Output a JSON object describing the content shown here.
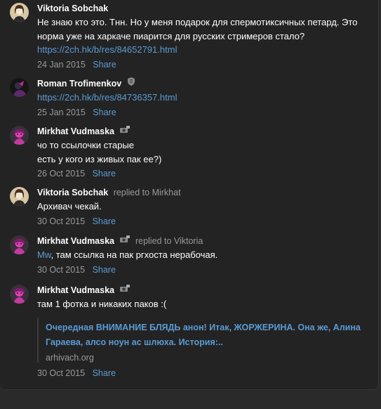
{
  "comments": [
    {
      "author": "Viktoria Sobchak",
      "line1": "Не знаю кто это. Тнн. Но у меня подарок для спермотиксичных петард. Это",
      "line2": "норма уже на харкаче пиарится для русских стримеров стало?",
      "link": "https://2ch.hk/b/res/84652791.html",
      "date": "24 Jan 2015",
      "share": "Share",
      "avatar_icon": "woman-portrait-avatar"
    },
    {
      "author": "Roman Trofimenkov",
      "badge_icon": "shield-icon",
      "link": "https://2ch.hk/b/res/84736357.html",
      "date": "25 Jan 2015",
      "share": "Share",
      "avatar_icon": "dark-figure-avatar"
    },
    {
      "author": "Mirkhat Vudmaska",
      "badge_icon": "camera-icon",
      "line1": "чо то ссылочки старые",
      "line2": "есть у кого из живых пак ее?)",
      "date": "26 Oct 2015",
      "share": "Share",
      "avatar_icon": "pink-character-avatar"
    },
    {
      "author": "Viktoria Sobchak",
      "replied": "replied to Mirkhat",
      "text": "Архивач чекай.",
      "date": "30 Oct 2015",
      "share": "Share",
      "avatar_icon": "woman-portrait-avatar"
    },
    {
      "author": "Mirkhat Vudmaska",
      "badge_icon": "camera-icon",
      "replied": "replied to Viktoria",
      "mention": "Mw",
      "text": ", там ссылка на пак ргхоста нерабочая.",
      "date": "30 Oct 2015",
      "share": "Share",
      "avatar_icon": "pink-character-avatar"
    },
    {
      "author": "Mirkhat Vudmaska",
      "badge_icon": "camera-icon",
      "text": "там 1 фотка и никаких паков :(",
      "quote_line1": "Очередная ВНИМАНИЕ БЛЯДЬ анон! Итак, ЖОРЖЕРИНА. Она же, Алина",
      "quote_line2": "Гараева, алсо ноун ас шлюха. История:..",
      "quote_domain": "arhivach.org",
      "date": "30 Oct 2015",
      "share": "Share",
      "avatar_icon": "pink-character-avatar"
    }
  ],
  "colors": {
    "background": "#2a2a2a",
    "panel": "#232323",
    "link": "#5b9bd5",
    "muted": "#9a9a9a",
    "text": "#ffffff"
  }
}
